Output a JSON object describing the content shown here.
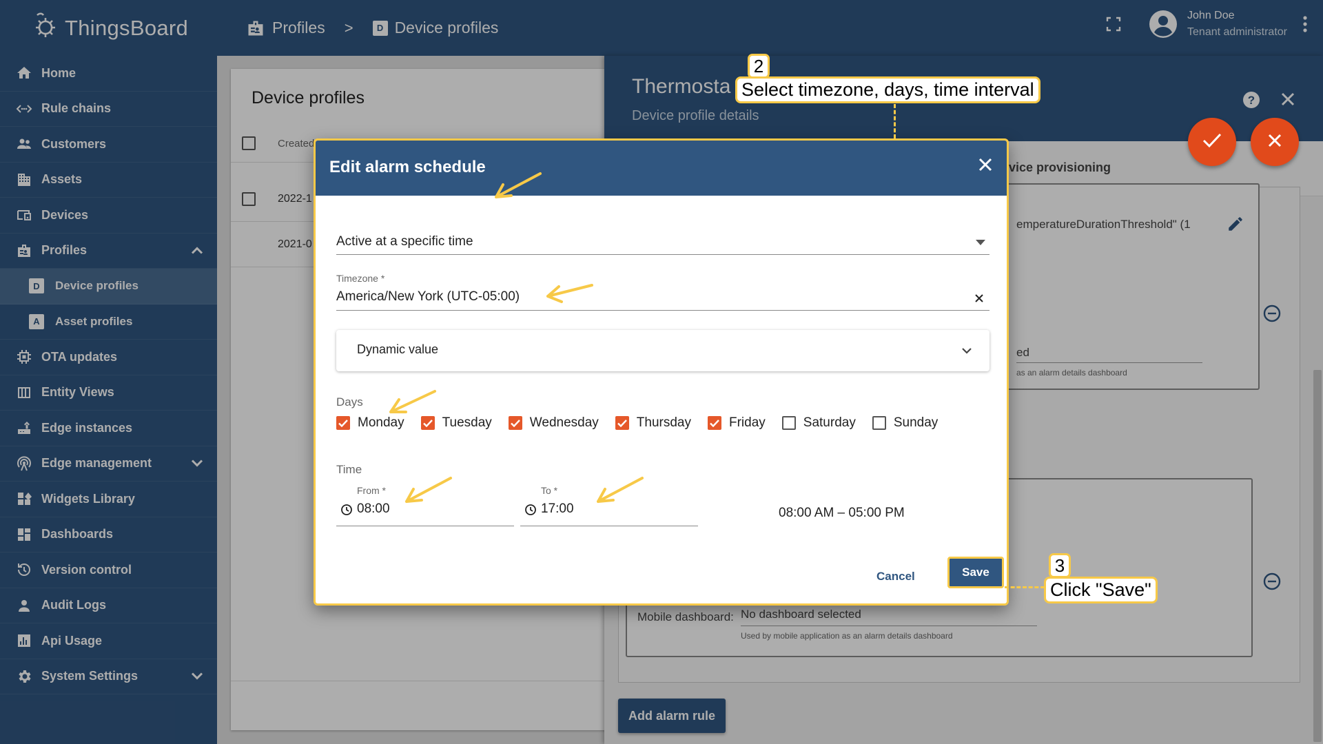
{
  "app": {
    "name": "ThingsBoard"
  },
  "sidebar": {
    "items": [
      {
        "label": "Home"
      },
      {
        "label": "Rule chains"
      },
      {
        "label": "Customers"
      },
      {
        "label": "Assets"
      },
      {
        "label": "Devices"
      },
      {
        "label": "Profiles"
      },
      {
        "label": "Device profiles",
        "badge": "D"
      },
      {
        "label": "Asset profiles",
        "badge": "A"
      },
      {
        "label": "OTA updates"
      },
      {
        "label": "Entity Views"
      },
      {
        "label": "Edge instances"
      },
      {
        "label": "Edge management"
      },
      {
        "label": "Widgets Library"
      },
      {
        "label": "Dashboards"
      },
      {
        "label": "Version control"
      },
      {
        "label": "Audit Logs"
      },
      {
        "label": "Api Usage"
      },
      {
        "label": "System Settings"
      }
    ]
  },
  "topbar": {
    "breadcrumb": [
      {
        "label": "Profiles"
      },
      {
        "label": "Device profiles",
        "badge": "D"
      }
    ],
    "separator": ">",
    "user": {
      "name": "John Doe",
      "role": "Tenant administrator"
    }
  },
  "list": {
    "title": "Device profiles",
    "column_created": "Created",
    "rows": [
      {
        "created": "2022-1"
      },
      {
        "created": "2021-0"
      }
    ]
  },
  "detail": {
    "title": "Thermosta",
    "subtitle": "Device profile details",
    "tab_partial": "evice provisioning",
    "rule1_text": "emperatureDurationThreshold\" (1",
    "rule1_dash_value": "ed",
    "rule1_dash_hint": "as an alarm details dashboard",
    "mobile_label": "Mobile dashboard:",
    "mobile_value": "No dashboard selected",
    "mobile_hint": "Used by mobile application as an alarm details dashboard",
    "add_rule": "Add alarm rule"
  },
  "modal": {
    "title": "Edit alarm schedule",
    "schedule_type": "Active at a specific time",
    "timezone_label": "Timezone *",
    "timezone_value": "America/New York (UTC-05:00)",
    "dynamic_value": "Dynamic value",
    "days_label": "Days",
    "days": [
      {
        "label": "Monday",
        "checked": true
      },
      {
        "label": "Tuesday",
        "checked": true
      },
      {
        "label": "Wednesday",
        "checked": true
      },
      {
        "label": "Thursday",
        "checked": true
      },
      {
        "label": "Friday",
        "checked": true
      },
      {
        "label": "Saturday",
        "checked": false
      },
      {
        "label": "Sunday",
        "checked": false
      }
    ],
    "time_label": "Time",
    "from_label": "From *",
    "from_value": "08:00",
    "to_label": "To *",
    "to_value": "17:00",
    "range_text": "08:00 AM – 05:00 PM",
    "cancel": "Cancel",
    "save": "Save"
  },
  "annotations": {
    "step2_number": "2",
    "step2_text": "Select timezone, days, time interval",
    "step3_number": "3",
    "step3_text": "Click \"Save\""
  },
  "colors": {
    "primary": "#305680",
    "accent": "#e14a1b",
    "checkbox": "#e5582a",
    "highlight": "#f7c948"
  }
}
